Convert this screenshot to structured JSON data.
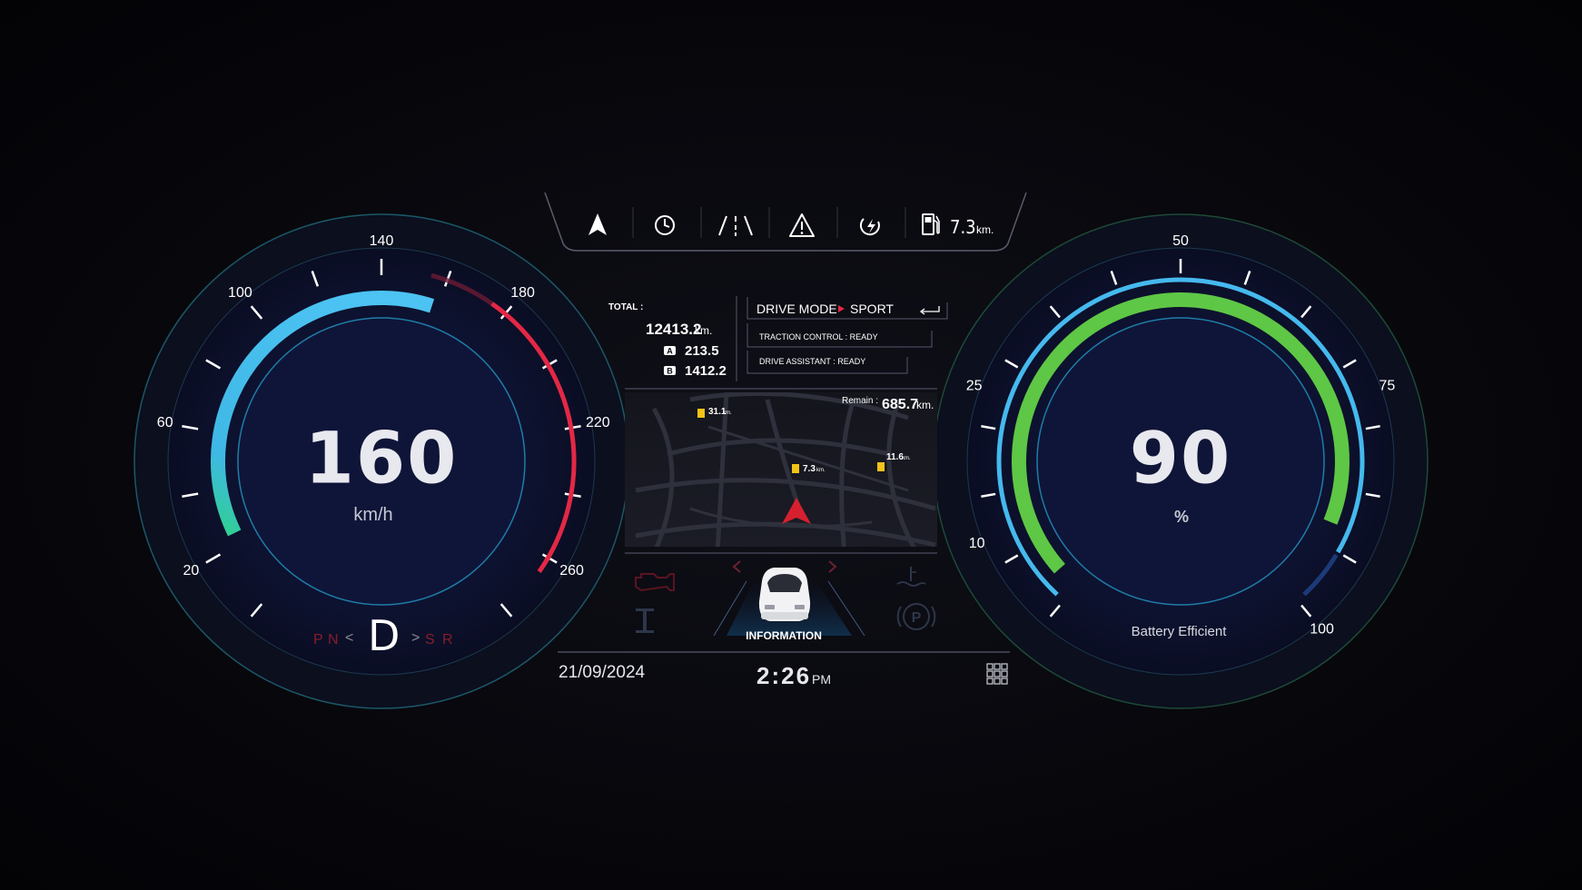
{
  "speedometer": {
    "value": "160",
    "unit": "km/h",
    "tick_labels": [
      "20",
      "60",
      "100",
      "140",
      "180",
      "220",
      "260"
    ],
    "gears": [
      "P",
      "N",
      "<",
      "D",
      ">",
      "S",
      "R"
    ],
    "active_gear": "D",
    "colors": {
      "arc": "#42b8ee",
      "arc_start": "#2fd08e",
      "redline": "#e32845"
    }
  },
  "battery_gauge": {
    "value": "90",
    "unit": "%",
    "label": "Battery Efficient",
    "tick_labels": [
      "10",
      "25",
      "50",
      "75",
      "100"
    ],
    "level": 0.9,
    "colors": {
      "arc": "#5ec745",
      "ring": "#42b8ee"
    }
  },
  "top_bar": {
    "icons": [
      "navigation-arrow-icon",
      "clock-icon",
      "lane-assist-icon",
      "warning-icon",
      "charging-icon",
      "fuel-pump-icon"
    ],
    "range_value": "7.3",
    "range_unit": "km."
  },
  "odometer": {
    "total_label": "TOTAL :",
    "total_value": "12413.2",
    "total_unit": "km.",
    "trip_a_label": "A",
    "trip_a_value": "213.5",
    "trip_b_label": "B",
    "trip_b_value": "1412.2"
  },
  "drive_mode": {
    "label": "DRIVE MODE",
    "value": "SPORT",
    "traction": "TRACTION CONTROL  : READY",
    "assistant": "DRIVE ASSISTANT  : READY"
  },
  "map": {
    "remain_label": "Remain :",
    "remain_value": "685.7",
    "remain_unit": "km.",
    "stations": [
      {
        "value": "31.1",
        "unit": "km."
      },
      {
        "value": "7.3",
        "unit": "km."
      },
      {
        "value": "11.6",
        "unit": "km."
      }
    ]
  },
  "info_panel": {
    "label": "INFORMATION",
    "icons": [
      "engine-warning-icon",
      "chassis-icon",
      "coolant-temp-icon",
      "parking-brake-icon",
      "chevron-left-icon",
      "chevron-right-icon",
      "car-icon"
    ]
  },
  "status_bar": {
    "date": "21/09/2024",
    "time": "2:26",
    "ampm": "PM",
    "menu_icon": "grid-menu-icon"
  }
}
